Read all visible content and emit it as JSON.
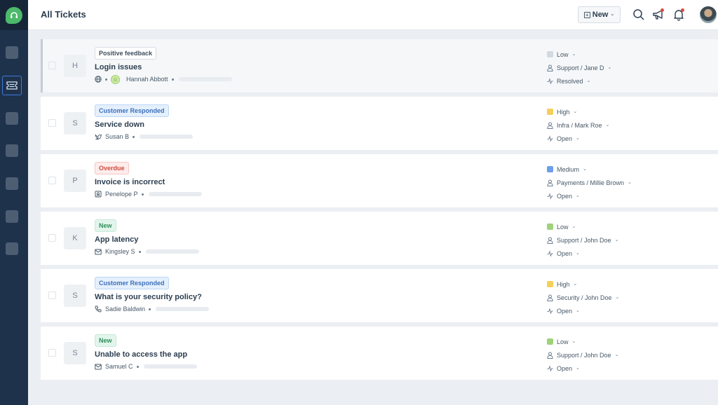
{
  "header": {
    "title": "All Tickets",
    "new_button": "New",
    "notifications_dot_color": "#e2493f"
  },
  "sidebar": {
    "logo": "headset-icon",
    "brand_color": "#4cb96b",
    "items": [
      {
        "icon": "placeholder-icon",
        "active": false
      },
      {
        "icon": "ticket-icon",
        "active": true
      },
      {
        "icon": "placeholder-icon",
        "active": false
      },
      {
        "icon": "placeholder-icon",
        "active": false
      },
      {
        "icon": "placeholder-icon",
        "active": false
      },
      {
        "icon": "placeholder-icon",
        "active": false
      },
      {
        "icon": "placeholder-icon",
        "active": false
      }
    ]
  },
  "tickets": [
    {
      "initial": "H",
      "tag": "Positive feedback",
      "tag_style": "neutral",
      "subject": "Login issues",
      "source_icon": "globe-icon",
      "requester": "Hannah Abbott",
      "sentiment": "happy",
      "priority": "Low",
      "priority_color": "#d3d9e0",
      "assignee": "Support / Jane D",
      "status": "Resolved",
      "selected": true
    },
    {
      "initial": "S",
      "tag": "Customer Responded",
      "tag_style": "blue",
      "subject": "Service down",
      "source_icon": "twitter-icon",
      "requester": "Susan B",
      "priority": "High",
      "priority_color": "#f5cf5b",
      "assignee": "Infra / Mark Roe",
      "status": "Open"
    },
    {
      "initial": "P",
      "tag": "Overdue",
      "tag_style": "red",
      "subject": "Invoice is incorrect",
      "source_icon": "portal-icon",
      "requester": "Penelope P",
      "priority": "Medium",
      "priority_color": "#6d9eeb",
      "assignee": "Payments / Millie Brown",
      "status": "Open"
    },
    {
      "initial": "K",
      "tag": "New",
      "tag_style": "green",
      "subject": "App latency",
      "source_icon": "email-icon",
      "requester": "Kingsley S",
      "priority": "Low",
      "priority_color": "#9fd27a",
      "assignee": "Support / John Doe",
      "status": "Open"
    },
    {
      "initial": "S",
      "tag": "Customer Responded",
      "tag_style": "blue",
      "subject": "What is your security policy?",
      "source_icon": "phone-icon",
      "requester": "Sadie Baldwin",
      "priority": "High",
      "priority_color": "#f5cf5b",
      "assignee": "Security / John Doe",
      "status": "Open"
    },
    {
      "initial": "S",
      "tag": "New",
      "tag_style": "green",
      "subject": "Unable to access the app",
      "source_icon": "email-icon",
      "requester": "Samuel C",
      "priority": "Low",
      "priority_color": "#9fd27a",
      "assignee": "Support / John Doe",
      "status": "Open"
    }
  ]
}
